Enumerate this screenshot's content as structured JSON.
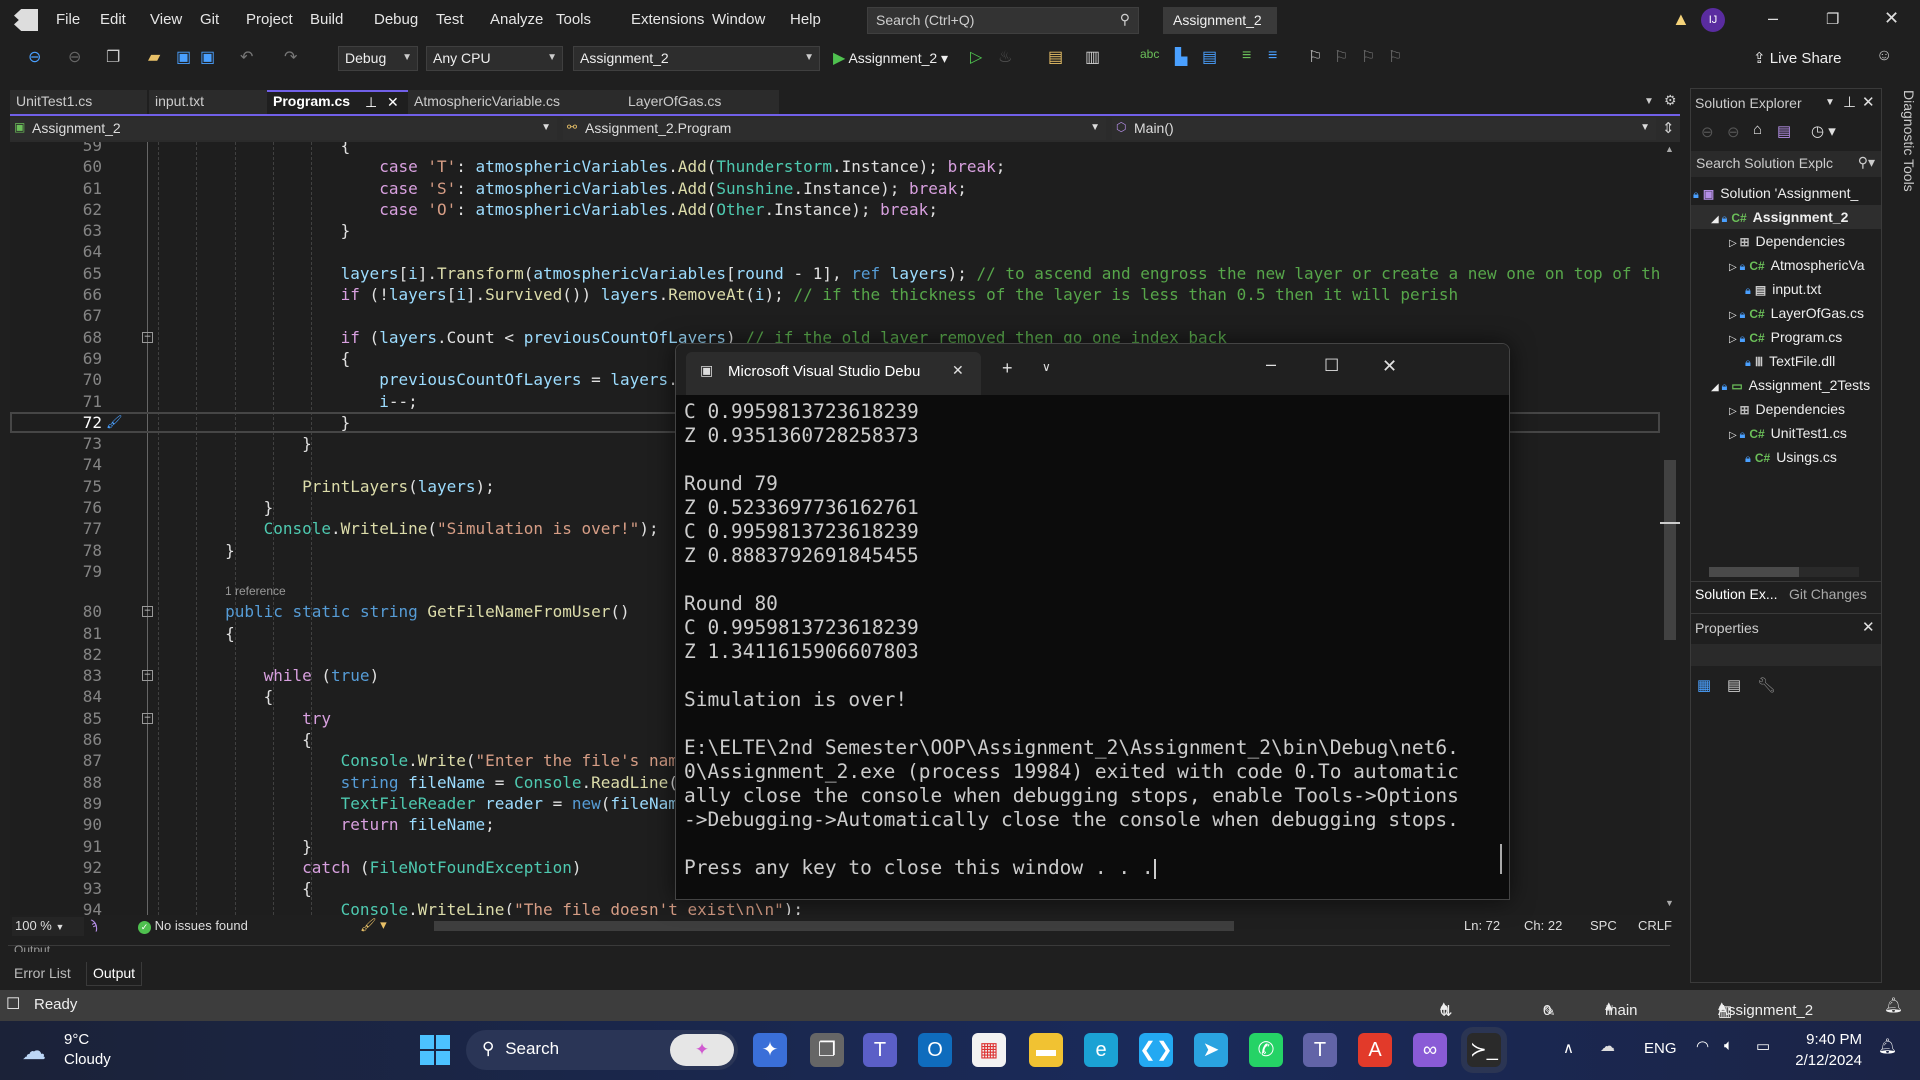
{
  "menubar": {
    "items": [
      "File",
      "Edit",
      "View",
      "Git",
      "Project",
      "Build",
      "Debug",
      "Test",
      "Analyze",
      "Tools",
      "Extensions",
      "Window",
      "Help"
    ],
    "search_placeholder": "Search (Ctrl+Q)",
    "solution_title": "Assignment_2",
    "avatar_initials": "IJ"
  },
  "toolbar": {
    "configuration": "Debug",
    "platform": "Any CPU",
    "startup_project": "Assignment_2",
    "run_label": "Assignment_2",
    "live_share": "Live Share"
  },
  "tabs": [
    {
      "label": "UnitTest1.cs"
    },
    {
      "label": "input.txt"
    },
    {
      "label": "Program.cs",
      "active": true
    },
    {
      "label": "AtmosphericVariable.cs"
    },
    {
      "label": "LayerOfGas.cs"
    }
  ],
  "navbar": {
    "project": "Assignment_2",
    "type": "Assignment_2.Program",
    "member": "Main()"
  },
  "editor": {
    "current_line": 72,
    "codelens": "1 reference",
    "lines": [
      {
        "n": 59,
        "indent": 20,
        "tokens": [
          [
            "{",
            ""
          ]
        ]
      },
      {
        "n": 60,
        "indent": 24,
        "tokens": [
          [
            "case",
            "c"
          ],
          [
            " ",
            ""
          ],
          [
            "'T'",
            "s"
          ],
          [
            ": ",
            ""
          ],
          [
            "atmosphericVariables",
            "v"
          ],
          [
            ".",
            ""
          ],
          [
            "Add",
            "m"
          ],
          [
            "(",
            ""
          ],
          [
            "Thunderstorm",
            "t"
          ],
          [
            ".Instance); ",
            ""
          ],
          [
            "break",
            "c"
          ],
          [
            ";",
            ""
          ]
        ]
      },
      {
        "n": 61,
        "indent": 24,
        "tokens": [
          [
            "case",
            "c"
          ],
          [
            " ",
            ""
          ],
          [
            "'S'",
            "s"
          ],
          [
            ": ",
            ""
          ],
          [
            "atmosphericVariables",
            "v"
          ],
          [
            ".",
            ""
          ],
          [
            "Add",
            "m"
          ],
          [
            "(",
            ""
          ],
          [
            "Sunshine",
            "t"
          ],
          [
            ".Instance); ",
            ""
          ],
          [
            "break",
            "c"
          ],
          [
            ";",
            ""
          ]
        ]
      },
      {
        "n": 62,
        "indent": 24,
        "tokens": [
          [
            "case",
            "c"
          ],
          [
            " ",
            ""
          ],
          [
            "'O'",
            "s"
          ],
          [
            ": ",
            ""
          ],
          [
            "atmosphericVariables",
            "v"
          ],
          [
            ".",
            ""
          ],
          [
            "Add",
            "m"
          ],
          [
            "(",
            ""
          ],
          [
            "Other",
            "t"
          ],
          [
            ".Instance); ",
            ""
          ],
          [
            "break",
            "c"
          ],
          [
            ";",
            ""
          ]
        ]
      },
      {
        "n": 63,
        "indent": 20,
        "tokens": [
          [
            "}",
            ""
          ]
        ]
      },
      {
        "n": 64,
        "indent": 0,
        "tokens": []
      },
      {
        "n": 65,
        "indent": 20,
        "tokens": [
          [
            "layers",
            "v"
          ],
          [
            "[",
            ""
          ],
          [
            "i",
            "v"
          ],
          [
            "].",
            ""
          ],
          [
            "Transform",
            "m"
          ],
          [
            "(",
            ""
          ],
          [
            "atmosphericVariables",
            "v"
          ],
          [
            "[",
            ""
          ],
          [
            "round",
            "v"
          ],
          [
            " - 1], ",
            ""
          ],
          [
            "ref",
            "k"
          ],
          [
            " ",
            ""
          ],
          [
            "layers",
            "v"
          ],
          [
            "); ",
            ""
          ],
          [
            "// to ascend and engross the new layer or create a new one on top of the",
            "cm"
          ]
        ]
      },
      {
        "n": 66,
        "indent": 20,
        "tokens": [
          [
            "if",
            "c"
          ],
          [
            " (!",
            ""
          ],
          [
            "layers",
            "v"
          ],
          [
            "[",
            ""
          ],
          [
            "i",
            "v"
          ],
          [
            "].",
            ""
          ],
          [
            "Survived",
            "m"
          ],
          [
            "()) ",
            ""
          ],
          [
            "layers",
            "v"
          ],
          [
            ".",
            ""
          ],
          [
            "RemoveAt",
            "m"
          ],
          [
            "(",
            ""
          ],
          [
            "i",
            "v"
          ],
          [
            "); ",
            ""
          ],
          [
            "// if the thickness of the layer is less than 0.5 then it will perish",
            "cm"
          ]
        ]
      },
      {
        "n": 67,
        "indent": 0,
        "tokens": []
      },
      {
        "n": 68,
        "indent": 20,
        "fold": true,
        "tokens": [
          [
            "if",
            "c"
          ],
          [
            " (",
            ""
          ],
          [
            "layers",
            "v"
          ],
          [
            ".Count < ",
            ""
          ],
          [
            "previousCountOfLayers",
            "v"
          ],
          [
            ") ",
            ""
          ],
          [
            "// if the old layer removed then go one index back",
            "cm"
          ]
        ]
      },
      {
        "n": 69,
        "indent": 20,
        "tokens": [
          [
            "{",
            ""
          ]
        ]
      },
      {
        "n": 70,
        "indent": 24,
        "tokens": [
          [
            "previousCountOfLayers",
            "v"
          ],
          [
            " = ",
            ""
          ],
          [
            "layers",
            "v"
          ],
          [
            ".",
            ""
          ]
        ]
      },
      {
        "n": 71,
        "indent": 24,
        "tokens": [
          [
            "i",
            "v"
          ],
          [
            "--;",
            ""
          ]
        ]
      },
      {
        "n": 72,
        "indent": 20,
        "tokens": [
          [
            "}",
            ""
          ]
        ]
      },
      {
        "n": 73,
        "indent": 16,
        "tokens": [
          [
            "}",
            ""
          ]
        ]
      },
      {
        "n": 74,
        "indent": 0,
        "tokens": []
      },
      {
        "n": 75,
        "indent": 16,
        "tokens": [
          [
            "PrintLayers",
            "m"
          ],
          [
            "(",
            ""
          ],
          [
            "layers",
            "v"
          ],
          [
            ");",
            ""
          ]
        ]
      },
      {
        "n": 76,
        "indent": 12,
        "tokens": [
          [
            "}",
            ""
          ]
        ]
      },
      {
        "n": 77,
        "indent": 12,
        "tokens": [
          [
            "Console",
            "t"
          ],
          [
            ".",
            ""
          ],
          [
            "WriteLine",
            "m"
          ],
          [
            "(",
            ""
          ],
          [
            "\"Simulation is over!\"",
            "s"
          ],
          [
            ");",
            ""
          ]
        ]
      },
      {
        "n": 78,
        "indent": 8,
        "tokens": [
          [
            "}",
            ""
          ]
        ]
      },
      {
        "n": 79,
        "indent": 0,
        "tokens": []
      },
      {
        "n": 80,
        "indent": 8,
        "fold": true,
        "lens": true,
        "tokens": [
          [
            "public",
            "k"
          ],
          [
            " ",
            ""
          ],
          [
            "static",
            "k"
          ],
          [
            " ",
            ""
          ],
          [
            "string",
            "k"
          ],
          [
            " ",
            ""
          ],
          [
            "GetFileNameFromUser",
            "m"
          ],
          [
            "()",
            ""
          ]
        ]
      },
      {
        "n": 81,
        "indent": 8,
        "tokens": [
          [
            "{",
            ""
          ]
        ]
      },
      {
        "n": 82,
        "indent": 0,
        "tokens": []
      },
      {
        "n": 83,
        "indent": 12,
        "fold": true,
        "tokens": [
          [
            "while",
            "c"
          ],
          [
            " (",
            ""
          ],
          [
            "true",
            "k"
          ],
          [
            ")",
            ""
          ]
        ]
      },
      {
        "n": 84,
        "indent": 12,
        "tokens": [
          [
            "{",
            ""
          ]
        ]
      },
      {
        "n": 85,
        "indent": 16,
        "fold": true,
        "tokens": [
          [
            "try",
            "c"
          ]
        ]
      },
      {
        "n": 86,
        "indent": 16,
        "tokens": [
          [
            "{",
            ""
          ]
        ]
      },
      {
        "n": 87,
        "indent": 20,
        "tokens": [
          [
            "Console",
            "t"
          ],
          [
            ".",
            ""
          ],
          [
            "Write",
            "m"
          ],
          [
            "(",
            ""
          ],
          [
            "\"Enter the file's nam",
            "s"
          ]
        ]
      },
      {
        "n": 88,
        "indent": 20,
        "tokens": [
          [
            "string",
            "k"
          ],
          [
            " ",
            ""
          ],
          [
            "fileName",
            "v"
          ],
          [
            " = ",
            ""
          ],
          [
            "Console",
            "t"
          ],
          [
            ".",
            ""
          ],
          [
            "ReadLine",
            "m"
          ],
          [
            "(",
            ""
          ]
        ]
      },
      {
        "n": 89,
        "indent": 20,
        "tokens": [
          [
            "TextFileReader",
            "t"
          ],
          [
            " ",
            ""
          ],
          [
            "reader",
            "v"
          ],
          [
            " = ",
            ""
          ],
          [
            "new",
            "k"
          ],
          [
            "(",
            ""
          ],
          [
            "fileNam",
            "v"
          ]
        ]
      },
      {
        "n": 90,
        "indent": 20,
        "tokens": [
          [
            "return",
            "c"
          ],
          [
            " ",
            ""
          ],
          [
            "fileName",
            "v"
          ],
          [
            ";",
            ""
          ]
        ]
      },
      {
        "n": 91,
        "indent": 16,
        "tokens": [
          [
            "}",
            ""
          ]
        ]
      },
      {
        "n": 92,
        "indent": 16,
        "tokens": [
          [
            "catch",
            "c"
          ],
          [
            " (",
            ""
          ],
          [
            "FileNotFoundException",
            "t"
          ],
          [
            ")",
            ""
          ]
        ]
      },
      {
        "n": 93,
        "indent": 16,
        "tokens": [
          [
            "{",
            ""
          ]
        ]
      },
      {
        "n": 94,
        "indent": 20,
        "tokens": [
          [
            "Console",
            "t"
          ],
          [
            ".",
            ""
          ],
          [
            "WriteLine",
            "m"
          ],
          [
            "(",
            ""
          ],
          [
            "\"The file doesn't exist\\n\\n\"",
            "s"
          ],
          [
            ");",
            ""
          ]
        ]
      }
    ]
  },
  "editor_status": {
    "zoom": "100 %",
    "issues": "No issues found",
    "line": "Ln: 72",
    "char": "Ch: 22",
    "whitespace": "SPC",
    "line_ending": "CRLF"
  },
  "bottom_panel": {
    "title": "Output",
    "tabs": [
      "Error List",
      "Output"
    ]
  },
  "statusbar": {
    "state": "Ready",
    "sync": "0 / 0",
    "pending": "0",
    "branch": "main",
    "repo": "Assignment_2"
  },
  "solution_explorer": {
    "title": "Solution Explorer",
    "search_placeholder": "Search Solution Explc",
    "items": [
      {
        "label": "Solution 'Assignment_",
        "icon": "solution-icon"
      },
      {
        "label": "Assignment_2",
        "icon": "csharp-project-icon",
        "expanded": true,
        "bold": true
      },
      {
        "label": "Dependencies",
        "icon": "dependencies-icon"
      },
      {
        "label": "AtmosphericVa",
        "icon": "csharp-file-icon"
      },
      {
        "label": "input.txt",
        "icon": "text-file-icon"
      },
      {
        "label": "LayerOfGas.cs",
        "icon": "csharp-file-icon"
      },
      {
        "label": "Program.cs",
        "icon": "csharp-file-icon"
      },
      {
        "label": "TextFile.dll",
        "icon": "library-icon"
      },
      {
        "label": "Assignment_2Tests",
        "icon": "test-project-icon",
        "expanded": true
      },
      {
        "label": "Dependencies",
        "icon": "dependencies-icon"
      },
      {
        "label": "UnitTest1.cs",
        "icon": "csharp-file-icon"
      },
      {
        "label": "Usings.cs",
        "icon": "csharp-file-icon"
      }
    ],
    "tabs": [
      "Solution Ex...",
      "Git Changes"
    ],
    "properties_title": "Properties",
    "diagnostic_tools": "Diagnostic Tools"
  },
  "console": {
    "title": "Microsoft Visual Studio Debu",
    "lines": [
      "C 0.9959813723618239",
      "Z 0.9351360728258373",
      "",
      "Round 79",
      "Z 0.5233697736162761",
      "C 0.9959813723618239",
      "Z 0.8883792691845455",
      "",
      "Round 80",
      "C 0.9959813723618239",
      "Z 1.3411615906607803",
      "",
      "Simulation is over!",
      "",
      "E:\\ELTE\\2nd Semester\\OOP\\Assignment_2\\Assignment_2\\bin\\Debug\\net6.",
      "0\\Assignment_2.exe (process 19984) exited with code 0.To automatic",
      "ally close the console when debugging stops, enable Tools->Options",
      "->Debugging->Automatically close the console when debugging stops.",
      "",
      "Press any key to close this window . . ."
    ]
  },
  "taskbar": {
    "weather_temp": "9°C",
    "weather_desc": "Cloudy",
    "search": "Search",
    "language": "ENG",
    "time": "9:40 PM",
    "date": "2/12/2024",
    "apps": [
      "copilot-preview",
      "task-view",
      "teams",
      "outlook-new",
      "microsoft-store",
      "file-explorer",
      "edge",
      "vscode",
      "telegram",
      "whatsapp",
      "teams-work",
      "acrobat",
      "visual-studio",
      "terminal"
    ]
  },
  "colors": {
    "accent": "#7160e8",
    "editor_bg": "#1e1e1e",
    "console_bg": "#0c0c0c",
    "comment": "#57a64a",
    "keyword": "#569cd6"
  }
}
